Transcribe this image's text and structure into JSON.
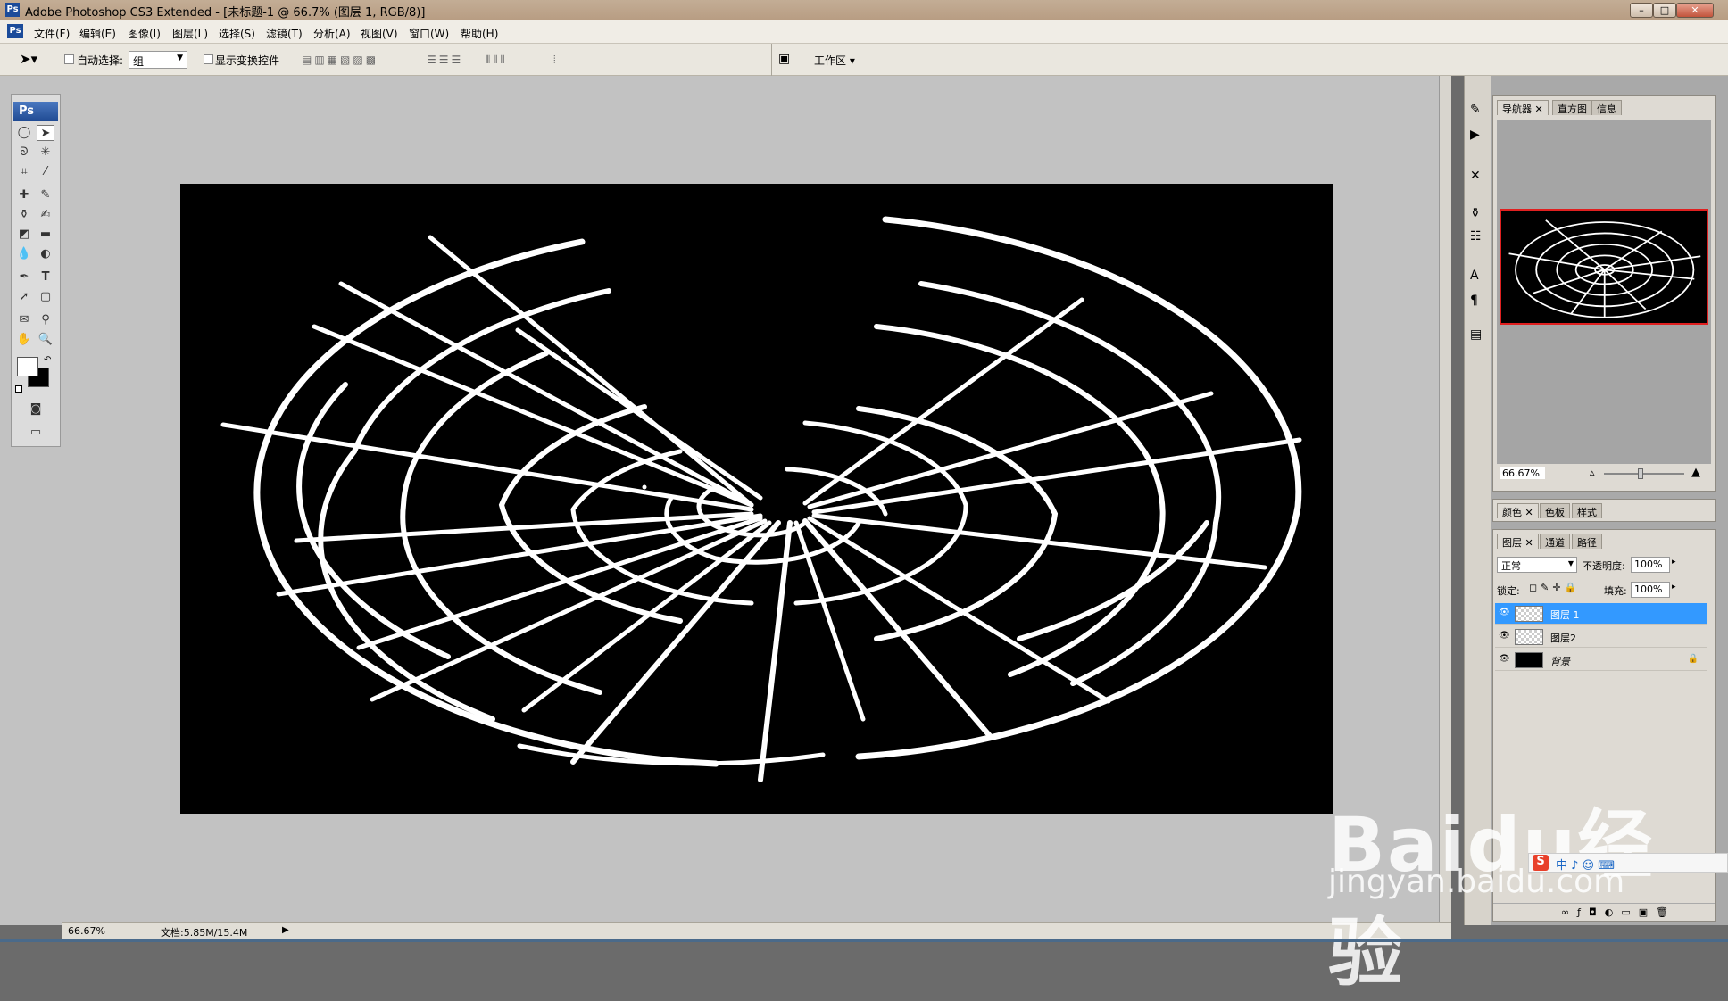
{
  "window": {
    "title": "Adobe Photoshop CS3 Extended - [未标题-1 @ 66.7% (图层 1, RGB/8)]",
    "app_icon": "Ps",
    "controls": [
      "–",
      "□",
      "✕"
    ]
  },
  "menu": [
    "文件(F)",
    "编辑(E)",
    "图像(I)",
    "图层(L)",
    "选择(S)",
    "滤镜(T)",
    "分析(A)",
    "视图(V)",
    "窗口(W)",
    "帮助(H)"
  ],
  "options": {
    "auto_select_label": "自动选择:",
    "auto_select_value": "组",
    "show_transform_label": "显示变换控件",
    "workspace_label": "工作区 ▾"
  },
  "toolbox": {
    "logo": "Ps",
    "tools": [
      "marquee-icon",
      "move-icon",
      "lasso-icon",
      "magic-wand-icon",
      "crop-icon",
      "slice-icon",
      "healing-icon",
      "brush-icon",
      "stamp-icon",
      "history-brush-icon",
      "eraser-icon",
      "gradient-icon",
      "blur-icon",
      "dodge-icon",
      "pen-icon",
      "type-icon",
      "path-select-icon",
      "shape-icon",
      "notes-icon",
      "eyedropper-icon",
      "hand-icon",
      "zoom-icon"
    ],
    "type_glyph": "T",
    "fg_color": "#ffffff",
    "bg_color": "#000000"
  },
  "status": {
    "zoom": "66.67%",
    "doc": "文档:5.85M/15.4M"
  },
  "navigator": {
    "tabs": [
      "导航器",
      "直方图",
      "信息"
    ],
    "zoom": "66.67%",
    "frame_color": "#e02020"
  },
  "color_panel": {
    "tabs": [
      "颜色",
      "色板",
      "样式"
    ]
  },
  "layers_panel": {
    "tabs": [
      "图层",
      "通道",
      "路径"
    ],
    "blend_mode": "正常",
    "opacity_label": "不透明度:",
    "opacity": "100%",
    "lock_label": "锁定:",
    "fill_label": "填充:",
    "fill": "100%",
    "layers": [
      {
        "name": "图层 1",
        "selected": true,
        "thumb": "transparent"
      },
      {
        "name": "图层2",
        "selected": false,
        "thumb": "transparent"
      },
      {
        "name": "背景",
        "selected": false,
        "thumb": "black",
        "locked": true
      }
    ]
  },
  "watermark": {
    "main": "Baidu经验",
    "url": "jingyan.baidu.com"
  },
  "ime_bar": {
    "text": "中 ♪ ☺ ⌨"
  },
  "accent_colors": {
    "selected_layer": "#3399ff",
    "canvas_bg": "#000000",
    "artwork": "#ffffff"
  }
}
